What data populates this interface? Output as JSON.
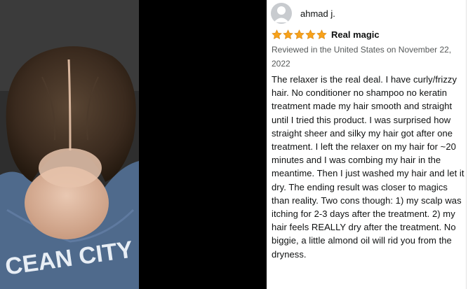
{
  "review": {
    "author": "ahmad j.",
    "rating": 5,
    "rating_max": 5,
    "headline": "Real magic",
    "meta": "Reviewed in the United States on November 22, 2022",
    "body": "The relaxer is the real deal. I have curly/frizzy hair. No conditioner no shampoo no keratin treatment made my hair smooth and straight until I tried this product. I was surprised how straight sheer and silky my hair got after one treatment. I left the relaxer on my hair for ~20 minutes and I was combing my hair in the meantime. Then I just washed my hair and let it dry. The ending result was closer to magics than reality. Two cons though: 1) my scalp was itching for 2-3 days after the treatment. 2) my hair feels REALLY dry after the treatment. No biggie, a little almond oil will rid you from the dryness."
  },
  "photo": {
    "shirt_text": "CEAN CITY"
  },
  "colors": {
    "star": "#f7a21b",
    "shirt": "#4f6a8c",
    "hair": "#3a2a1e"
  },
  "icons": {
    "avatar": "default-profile-icon",
    "star": "star-icon"
  }
}
